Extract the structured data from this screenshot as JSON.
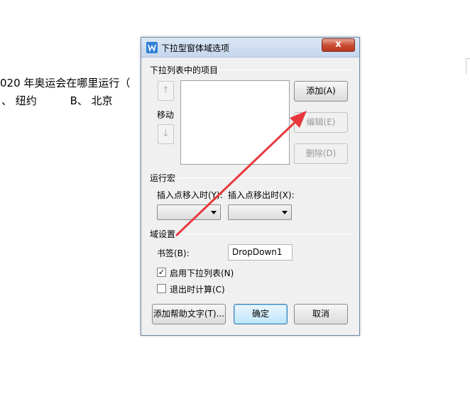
{
  "document": {
    "line1": "020 年奥运会在哪里运行（",
    "line2_a": "、 纽约",
    "line2_b": "B、 北京"
  },
  "dialog": {
    "title": "下拉型窗体域选项",
    "close_label": "x",
    "list_group": {
      "label": "下拉列表中的项目",
      "up_arrow": "↑",
      "down_arrow": "↓",
      "move_label": "移动",
      "add_button": "添加(A)",
      "edit_button": "编辑(E)",
      "delete_button": "删除(D)"
    },
    "macro_group": {
      "label": "运行宏",
      "on_entry_label": "插入点移入时(Y):",
      "on_exit_label": "插入点移出时(X):",
      "on_entry_value": "",
      "on_exit_value": ""
    },
    "field_group": {
      "label": "域设置",
      "bookmark_label": "书签(B):",
      "bookmark_value": "DropDown1",
      "enable_dropdown_label": "启用下拉列表(N)",
      "enable_dropdown_checked": "✓",
      "calc_on_exit_label": "退出时计算(C)",
      "calc_on_exit_checked": ""
    },
    "footer": {
      "help_button": "添加帮助文字(T)...",
      "ok_button": "确定",
      "cancel_button": "取消"
    }
  },
  "colors": {
    "annotation_arrow": "#e8383d",
    "title_bar": "#c5d6ee",
    "close_button": "#c8492f"
  }
}
